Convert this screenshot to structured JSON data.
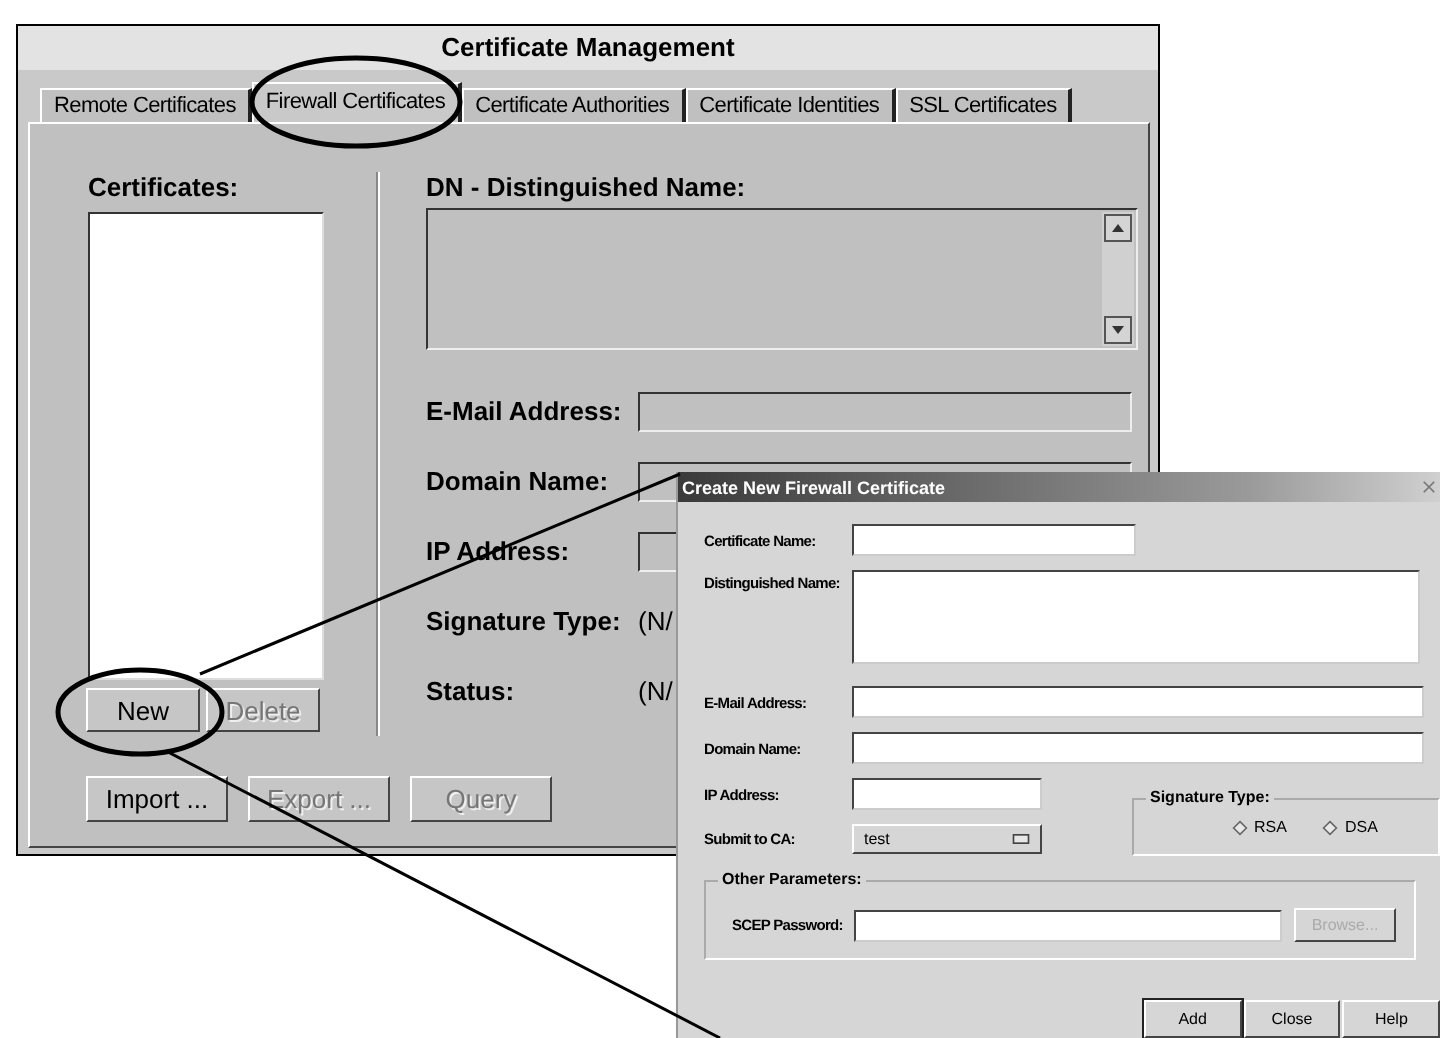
{
  "main_window": {
    "title": "Certificate Management",
    "tabs": [
      {
        "label": "Remote Certificates",
        "selected": false
      },
      {
        "label": "Firewall Certificates",
        "selected": true
      },
      {
        "label": "Certificate Authorities",
        "selected": false
      },
      {
        "label": "Certificate Identities",
        "selected": false
      },
      {
        "label": "SSL Certificates",
        "selected": false
      }
    ],
    "certificates_label": "Certificates:",
    "dn_label": "DN - Distinguished Name:",
    "fields": [
      {
        "label": "E-Mail Address:",
        "kind": "input"
      },
      {
        "label": "Domain Name:",
        "kind": "input"
      },
      {
        "label": "IP Address:",
        "kind": "input"
      },
      {
        "label": "Signature Type:",
        "kind": "value",
        "value": "(N/"
      },
      {
        "label": "Status:",
        "kind": "value",
        "value": "(N/"
      }
    ],
    "list_buttons": [
      {
        "label": "New",
        "disabled": false
      },
      {
        "label": "Delete",
        "disabled": true
      }
    ],
    "buttons": [
      {
        "label": "Import ...",
        "disabled": false
      },
      {
        "label": "Export ...",
        "disabled": true
      },
      {
        "label": "Query",
        "disabled": true
      }
    ]
  },
  "dialog": {
    "title": "Create New Firewall Certificate",
    "fields": [
      {
        "label": "Certificate Name:",
        "kind": "short"
      },
      {
        "label": "Distinguished Name:",
        "kind": "textarea"
      },
      {
        "label": "E-Mail Address:",
        "kind": "wide"
      },
      {
        "label": "Domain Name:",
        "kind": "wide"
      }
    ],
    "ip_label": "IP Address:",
    "submit_label": "Submit to CA:",
    "submit_value": "test",
    "signature_type": {
      "legend": "Signature Type:",
      "options": [
        {
          "label": "RSA",
          "selected": false
        },
        {
          "label": "DSA",
          "selected": false
        }
      ]
    },
    "other_parameters": {
      "legend": "Other Parameters:",
      "label": "SCEP Password:",
      "browse": {
        "label": "Browse...",
        "disabled": true
      }
    },
    "buttons": [
      {
        "label": "Add",
        "default": true
      },
      {
        "label": "Close",
        "default": false
      },
      {
        "label": "Help",
        "default": false
      }
    ]
  }
}
